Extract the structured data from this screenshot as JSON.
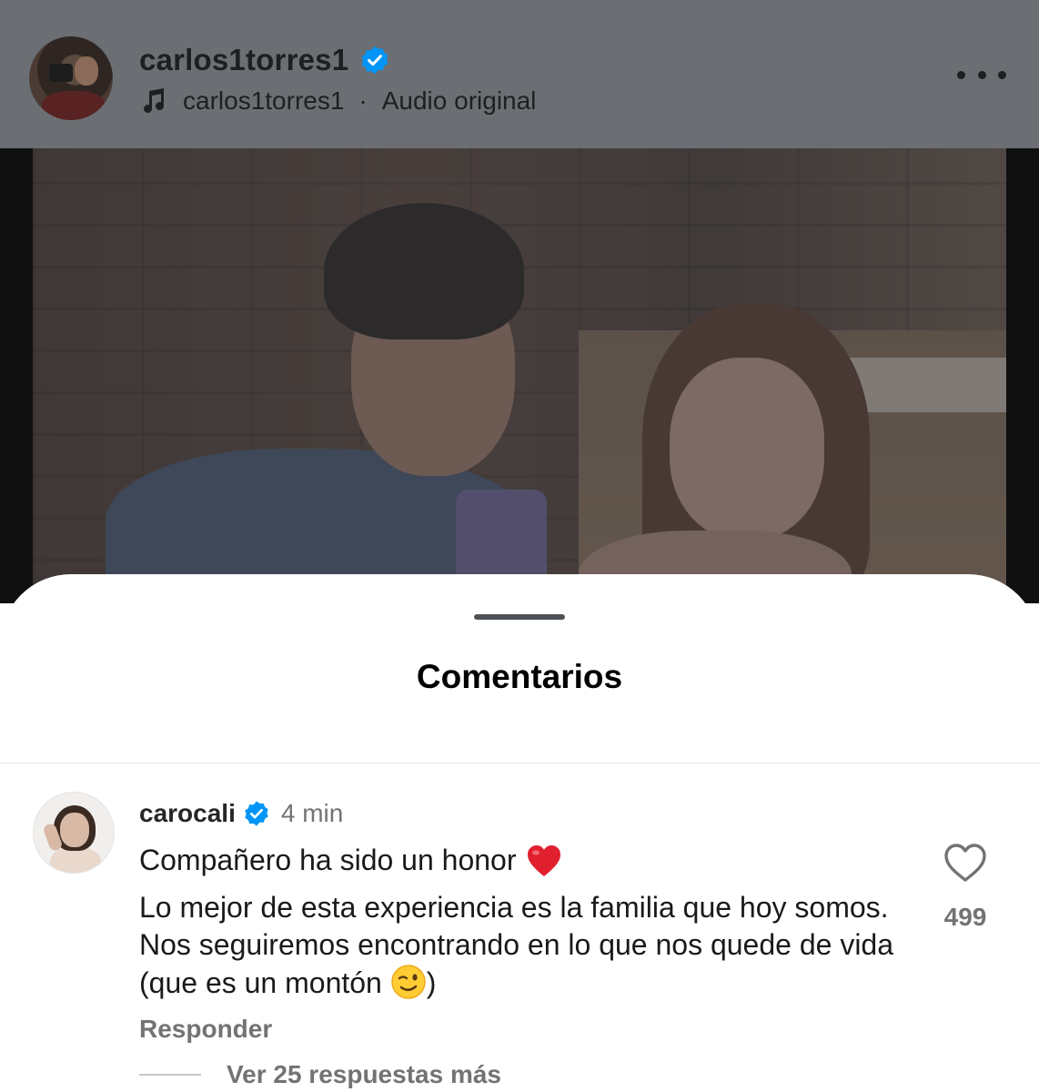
{
  "post": {
    "username": "carlos1torres1",
    "audio_author": "carlos1torres1",
    "audio_separator": "·",
    "audio_label": "Audio original"
  },
  "sheet": {
    "title": "Comentarios"
  },
  "comment": {
    "username": "carocali",
    "time": "4 min",
    "line1": "Compañero ha sido un honor",
    "body": "Lo mejor de esta experiencia es la familia que hoy somos. Nos seguiremos encontrando en lo que nos quede de vida (que es un montón",
    "body_end": ")",
    "reply_label": "Responder",
    "view_replies_label": "Ver 25 respuestas más",
    "like_count": "499"
  },
  "colors": {
    "verified_blue": "#0095f6",
    "heart_red": "#e0202f",
    "muted_text": "#737373"
  },
  "icons": [
    "verified-badge-icon",
    "music-note-icon",
    "more-options-icon",
    "red-heart-emoji",
    "winking-face-emoji",
    "heart-outline-icon"
  ]
}
